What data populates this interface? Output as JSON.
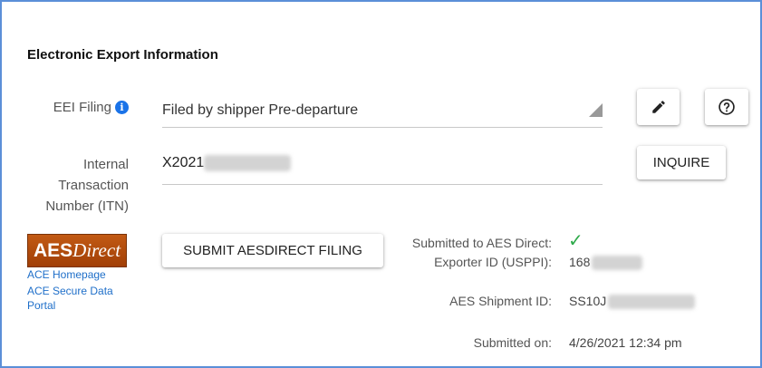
{
  "section": {
    "title": "Electronic Export Information"
  },
  "eei_filing": {
    "label": "EEI Filing",
    "info_icon": "info-icon",
    "value": "Filed by shipper Pre-departure"
  },
  "itn": {
    "label_line1": "Internal",
    "label_line2": "Transaction",
    "label_line3": "Number (ITN)",
    "value_visible": "X2021"
  },
  "buttons": {
    "edit_icon": "pencil-icon",
    "help_icon": "question-circle-icon",
    "inquire": "INQUIRE",
    "submit": "SUBMIT AESDIRECT FILING"
  },
  "aes_logo": {
    "part1": "AES",
    "part2": "Direct"
  },
  "links": {
    "ace_homepage": "ACE Homepage",
    "ace_secure_line1": "ACE Secure Data",
    "ace_secure_line2": "Portal"
  },
  "status": {
    "submitted_label": "Submitted to AES Direct:",
    "submitted_icon": "check-icon",
    "submitted_color": "#2eaa4a",
    "exporter_label": "Exporter ID (USPPI):",
    "exporter_value_visible": "168",
    "shipment_label": "AES Shipment ID:",
    "shipment_value_visible": "SS10J",
    "submitted_on_label": "Submitted on:",
    "submitted_on_value": "4/26/2021 12:34 pm"
  },
  "colors": {
    "frame_border": "#5b8fd8",
    "info_icon": "#1a73e8",
    "link": "#1f6fc9"
  }
}
